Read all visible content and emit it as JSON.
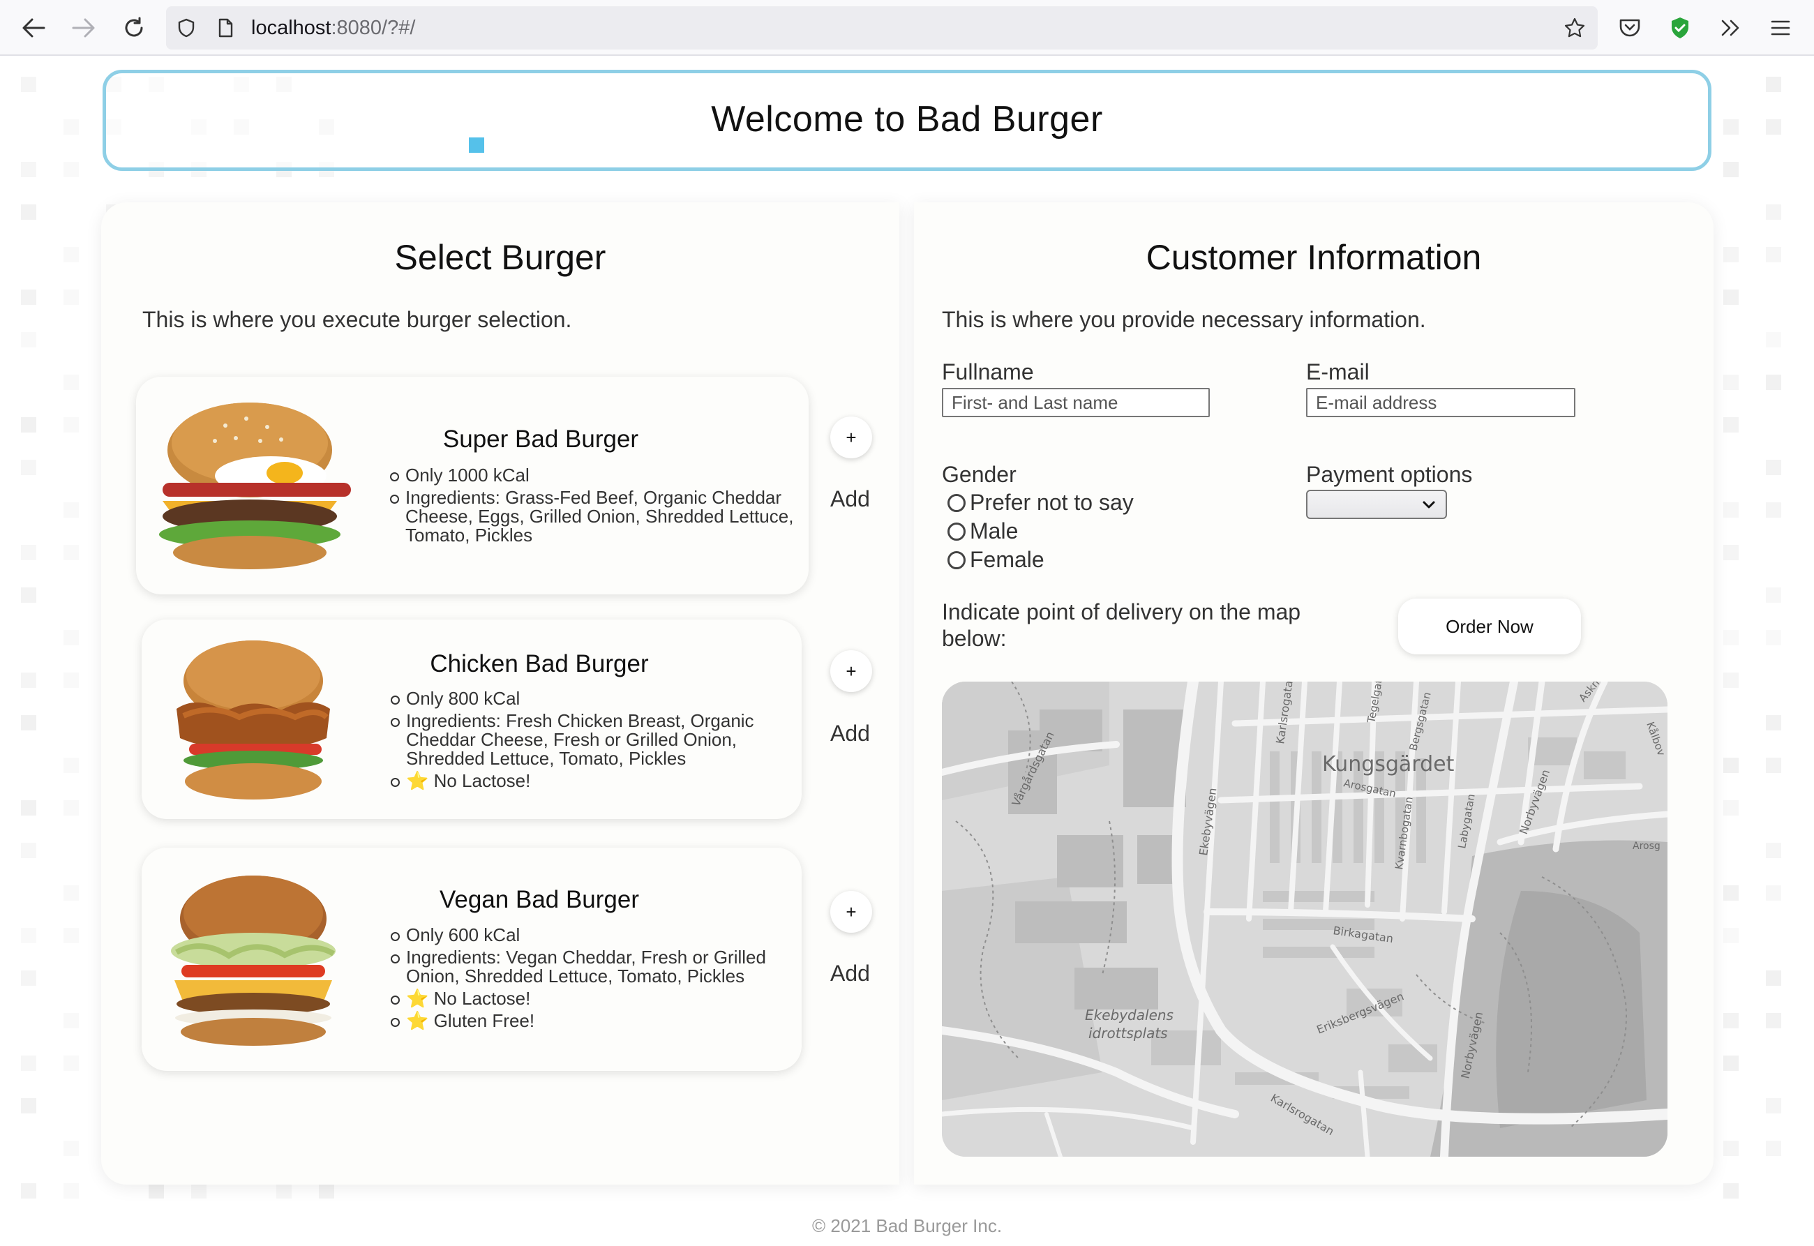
{
  "browser": {
    "url_host": "localhost",
    "url_rest": ":8080/?#/"
  },
  "header": {
    "title": "Welcome to Bad Burger"
  },
  "burger_panel": {
    "title": "Select Burger",
    "subtitle": "This is where you execute burger selection.",
    "add_label": "Add",
    "plus_label": "+",
    "burgers": [
      {
        "name": "Super Bad Burger",
        "details": [
          "Only 1000 kCal",
          "Ingredients: Grass-Fed Beef, Organic Cheddar Cheese, Eggs, Grilled Onion, Shredded Lettuce, Tomato, Pickles"
        ]
      },
      {
        "name": "Chicken Bad Burger",
        "details": [
          "Only 800 kCal",
          "Ingredients: Fresh Chicken Breast, Organic Cheddar Cheese, Fresh or Grilled Onion, Shredded Lettuce, Tomato, Pickles",
          "⭐ No Lactose!"
        ]
      },
      {
        "name": "Vegan Bad Burger",
        "details": [
          "Only 600 kCal",
          "Ingredients: Vegan Cheddar, Fresh or Grilled Onion, Shredded Lettuce, Tomato, Pickles",
          "⭐ No Lactose!",
          "⭐ Gluten Free!"
        ]
      }
    ]
  },
  "customer_panel": {
    "title": "Customer Information",
    "subtitle": "This is where you provide necessary information.",
    "fullname_label": "Fullname",
    "fullname_placeholder": "First- and Last name",
    "email_label": "E-mail",
    "email_placeholder": "E-mail address",
    "gender_label": "Gender",
    "gender_options": [
      "Prefer not to say",
      "Male",
      "Female"
    ],
    "payment_label": "Payment options",
    "payment_selected": "",
    "delivery_text": "Indicate point of delivery on the map below:",
    "order_button": "Order Now"
  },
  "map": {
    "labels": [
      "Kungsgärdet",
      "Ekebydalens idrottsplats",
      "Birkagatan",
      "Eriksbergsvägen",
      "Norbyvägen",
      "Ekebyvägen",
      "Vårgårdsgatan",
      "Karlsrogatan",
      "Arosgatan",
      "Kvarnbogatan",
      "Labygatan",
      "Tegelgatan",
      "Bergsgatan",
      "Norbyvägen",
      "Karlsrogatan",
      "Arosg",
      "Kålbov",
      "Askn"
    ]
  },
  "footer": {
    "text": "© 2021 Bad Burger Inc."
  },
  "colors": {
    "header_border": "#8ecfe6",
    "accent": "#55c1ea",
    "panel_bg": "#fdfdfb"
  }
}
